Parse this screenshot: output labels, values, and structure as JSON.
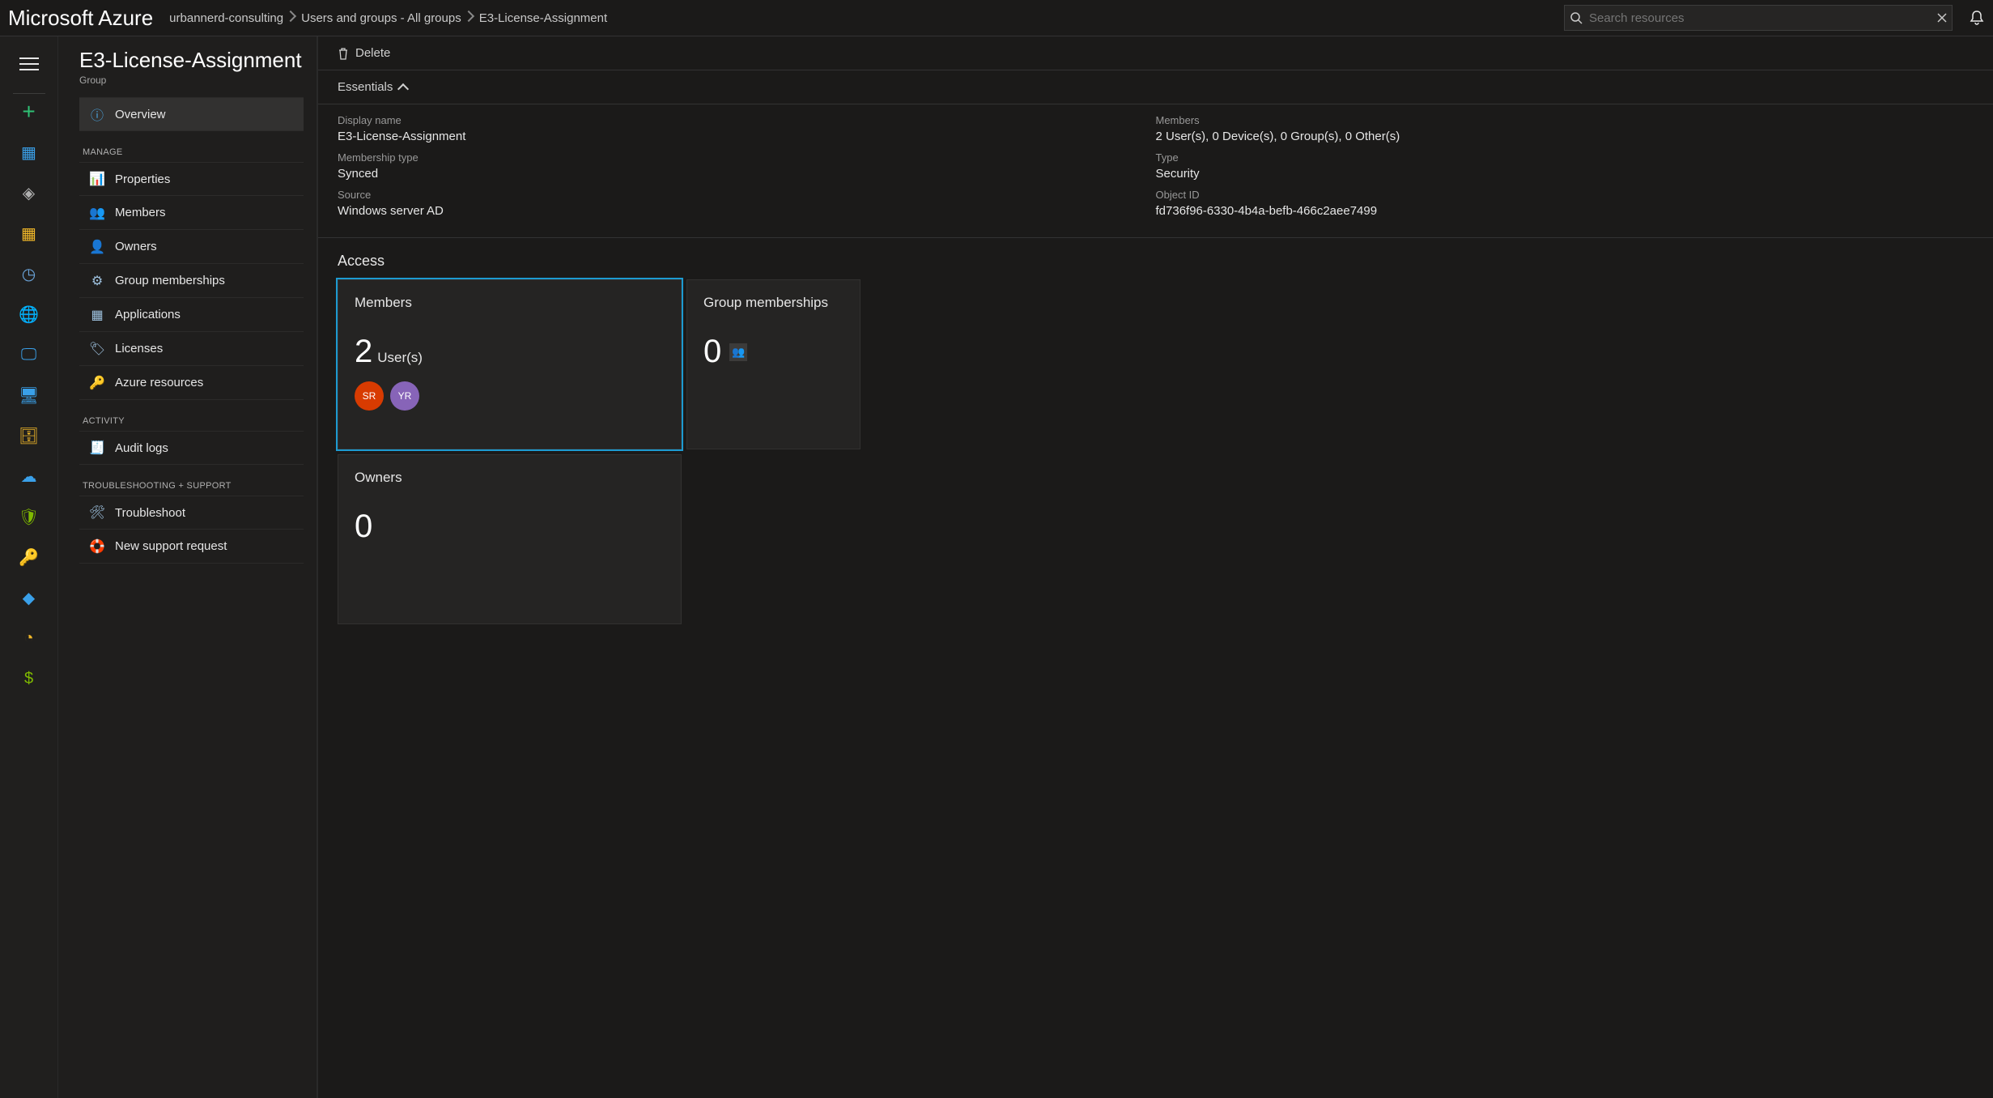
{
  "brand": "Microsoft Azure",
  "breadcrumb": {
    "tenant": "urbannerd-consulting",
    "groups": "Users and groups - All groups",
    "current": "E3-License-Assignment"
  },
  "search": {
    "placeholder": "Search resources"
  },
  "blade": {
    "title": "E3-License-Assignment",
    "subtitle": "Group",
    "overview_label": "Overview",
    "sect_manage": "MANAGE",
    "sect_activity": "ACTIVITY",
    "sect_support": "TROUBLESHOOTING + SUPPORT",
    "items": {
      "properties": "Properties",
      "members": "Members",
      "owners": "Owners",
      "group_memberships": "Group memberships",
      "applications": "Applications",
      "licenses": "Licenses",
      "azure_resources": "Azure resources",
      "audit_logs": "Audit logs",
      "troubleshoot": "Troubleshoot",
      "new_support": "New support request"
    }
  },
  "cmd": {
    "delete": "Delete"
  },
  "essentials": {
    "header": "Essentials",
    "left": {
      "display_name_label": "Display name",
      "display_name_value": "E3-License-Assignment",
      "membership_type_label": "Membership type",
      "membership_type_value": "Synced",
      "source_label": "Source",
      "source_value": "Windows server AD"
    },
    "right": {
      "members_label": "Members",
      "members_value": "2 User(s), 0 Device(s), 0 Group(s), 0 Other(s)",
      "type_label": "Type",
      "type_value": "Security",
      "object_id_label": "Object ID",
      "object_id_value": "fd736f96-6330-4b4a-befb-466c2aee7499"
    }
  },
  "access": {
    "title": "Access",
    "members_card": {
      "title": "Members",
      "count": "2",
      "unit": "User(s)",
      "avatars": [
        {
          "initials": "SR",
          "color": "#d83b01"
        },
        {
          "initials": "YR",
          "color": "#8764b8"
        }
      ]
    },
    "gm_card": {
      "title": "Group memberships",
      "count": "0"
    },
    "owners_card": {
      "title": "Owners",
      "count": "0"
    }
  }
}
